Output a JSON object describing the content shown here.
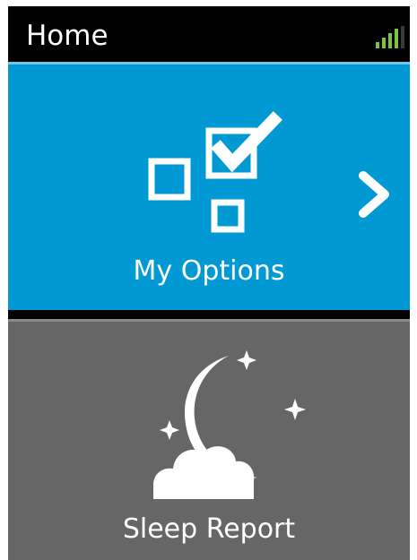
{
  "header": {
    "title": "Home",
    "signal_icon": "signal-bars-icon"
  },
  "tiles": [
    {
      "label": "My Options",
      "icon": "checkbox-options-icon",
      "nav_icon": "chevron-right-icon",
      "color": "#0099d3"
    },
    {
      "label": "Sleep Report",
      "icon": "moon-stars-cloud-icon",
      "color": "#666666"
    }
  ],
  "colors": {
    "background": "#000000",
    "signal": "#7dc242"
  }
}
